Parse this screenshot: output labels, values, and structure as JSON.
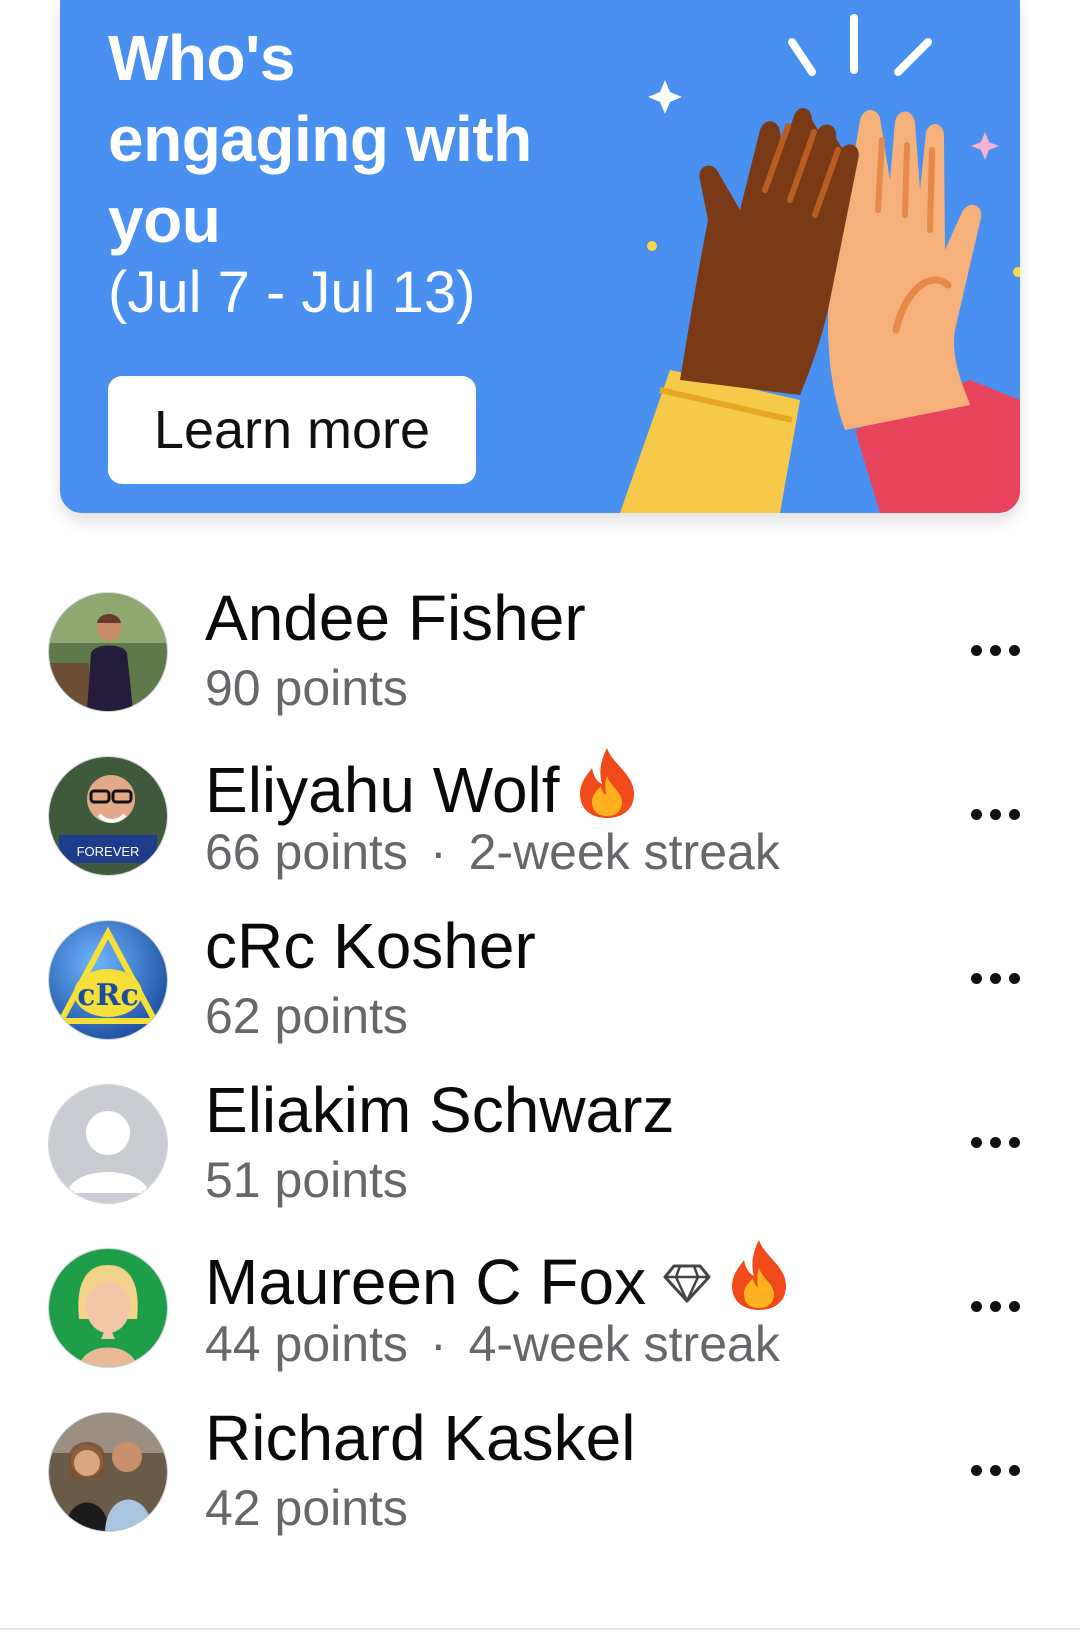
{
  "banner": {
    "title": "Who's engaging with you",
    "dates": "(Jul 7 - Jul 13)",
    "button_label": "Learn more"
  },
  "colors": {
    "banner_bg": "#4a90f0",
    "name_text": "#0a0a0a",
    "secondary_text": "#65676b"
  },
  "people": [
    {
      "name": "Andee Fisher",
      "points": "90 points",
      "streak": "",
      "badges": []
    },
    {
      "name": "Eliyahu Wolf",
      "points": "66 points",
      "streak": "2-week streak",
      "badges": [
        "fire-icon"
      ]
    },
    {
      "name": "cRc Kosher",
      "points": "62 points",
      "streak": "",
      "badges": []
    },
    {
      "name": "Eliakim Schwarz",
      "points": "51 points",
      "streak": "",
      "badges": []
    },
    {
      "name": "Maureen C Fox",
      "points": "44 points",
      "streak": "4-week streak",
      "badges": [
        "diamond-icon",
        "fire-icon"
      ]
    },
    {
      "name": "Richard Kaskel",
      "points": "42 points",
      "streak": "",
      "badges": []
    }
  ],
  "separator": "·",
  "row_actions": {
    "more_icon": "more-options-icon"
  }
}
